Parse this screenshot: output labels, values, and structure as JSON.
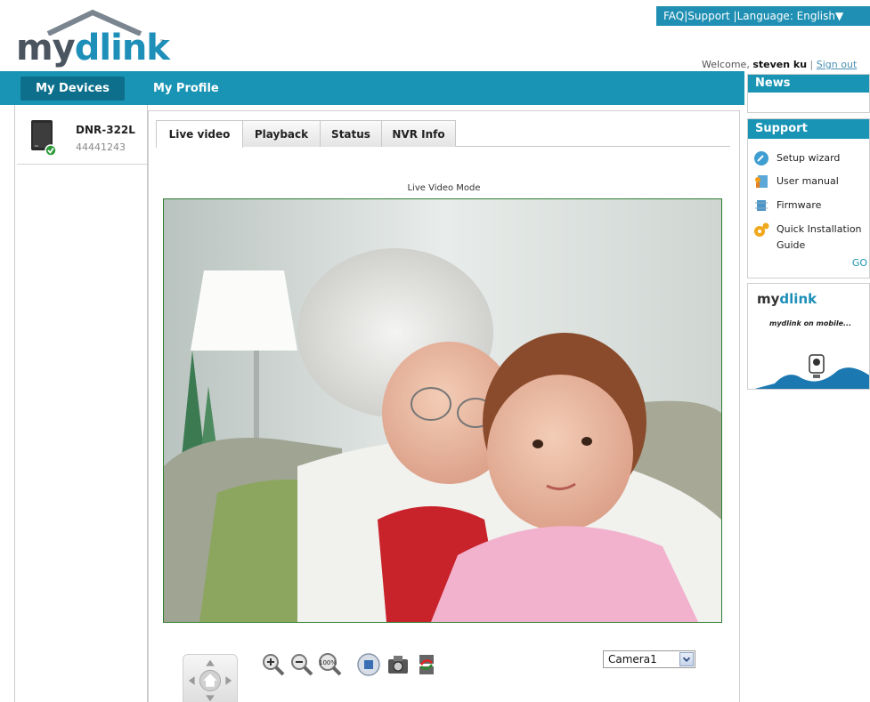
{
  "logo": {
    "my": "my",
    "dlink": "dlink",
    "tm": "™"
  },
  "top_links": {
    "faq": "FAQ",
    "support": "Support",
    "language": "Language: English▼"
  },
  "welcome": {
    "prefix": "Welcome,",
    "user": "steven ku",
    "sep": "|",
    "signout": "Sign out"
  },
  "nav": {
    "my_devices": "My Devices",
    "my_profile": "My Profile"
  },
  "device": {
    "name": "DNR-322L",
    "id": "44441243",
    "status_icon": "online-check-icon"
  },
  "tabs": [
    {
      "label": "Live video"
    },
    {
      "label": "Playback"
    },
    {
      "label": "Status"
    },
    {
      "label": "NVR Info"
    }
  ],
  "mode_label": "Live Video Mode",
  "camera_select": {
    "value": "Camera1"
  },
  "controls": [
    "ptz-home-icon",
    "zoom-in-icon",
    "zoom-out-icon",
    "zoom-100-icon",
    "full-screen-icon",
    "snapshot-icon",
    "recording-icon"
  ],
  "news": {
    "title": "News"
  },
  "support": {
    "title": "Support",
    "items": [
      {
        "label": "Setup wizard",
        "icon": "setup-wizard-icon"
      },
      {
        "label": "User manual",
        "icon": "user-manual-icon"
      },
      {
        "label": "Firmware",
        "icon": "firmware-icon"
      },
      {
        "label": "Quick Installation",
        "label2": "Guide",
        "icon": "quick-install-icon"
      }
    ],
    "go": "GO"
  },
  "promo": {
    "my": "my",
    "dlink": "dlink",
    "text": "mydlink on mobile..."
  },
  "colors": {
    "brand_blue": "#1994b5",
    "brand_dark": "#0d6f8c",
    "video_border": "#2e7d32"
  }
}
